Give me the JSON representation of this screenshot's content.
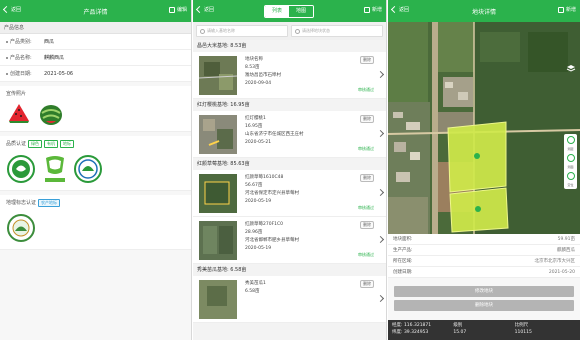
{
  "colors": {
    "accent": "#2bb24c",
    "map_field": "#cfe94a"
  },
  "p1": {
    "header": {
      "back": "返回",
      "title": "产品详情",
      "action": "编辑"
    },
    "section": "产品信息",
    "fields": [
      {
        "label": "产品类别:",
        "value": "西瓜"
      },
      {
        "label": "产品名称:",
        "value": "麒麟西瓜"
      },
      {
        "label": "创建日期:",
        "value": "2021-05-06"
      }
    ],
    "photos_title": "宣传照片",
    "cert_title": "品质认证",
    "cert_tags": [
      "绿色",
      "有机",
      "地标"
    ],
    "geo_title": "地理标志认证",
    "geo_tag": "农产地标"
  },
  "p2": {
    "header": {
      "back": "返回",
      "tab_list": "列表",
      "tab_map": "地图",
      "action": "新增"
    },
    "search": {
      "left": "请输入基地名称",
      "right": "请选择地块状态"
    },
    "groups": [
      {
        "title": "昌邑大米基地: 8.53亩",
        "items": [
          {
            "name": "地块名称",
            "area": "8.53亩",
            "addr": "潍坊昌邑市石埠村",
            "date": "2020-09-04",
            "del": "删除",
            "status": "审核通过"
          }
        ]
      },
      {
        "title": "红灯樱桃基地: 16.95亩",
        "items": [
          {
            "name": "红灯樱桃1",
            "area": "16.95亩",
            "addr": "山东省济宁市任城区西王庄村",
            "date": "2020-05-21",
            "del": "删除",
            "status": "审核通过"
          }
        ]
      },
      {
        "title": "红颜草莓基地: 85.63亩",
        "items": [
          {
            "name": "红颜草莓1610C48",
            "area": "56.67亩",
            "addr": "河北省保定市定兴县草莓村",
            "date": "2020-05-19",
            "del": "删除",
            "status": "审核通过"
          },
          {
            "name": "红颜草莓270F1C0",
            "area": "28.96亩",
            "addr": "河北省邯郸市肥乡县草莓村",
            "date": "2020-05-19",
            "del": "删除",
            "status": "审核通过"
          }
        ]
      },
      {
        "title": "秀美苗瓜基地: 6.58亩",
        "items": [
          {
            "name": "秀美苗瓜1",
            "area": "6.58亩",
            "addr": "",
            "date": "",
            "del": "删除",
            "status": ""
          }
        ]
      }
    ]
  },
  "p3": {
    "header": {
      "back": "返回",
      "title": "地块详情",
      "action": "新增"
    },
    "tools": [
      "测距",
      "测面",
      "定位"
    ],
    "info": [
      {
        "label": "地块面积:",
        "value": "59.91亩"
      },
      {
        "label": "生产产品:",
        "value": "麒麟西瓜"
      },
      {
        "label": "所在区域:",
        "value": "北京市北京市大兴区"
      },
      {
        "label": "创建日期:",
        "value": "2021-05-20"
      }
    ],
    "btn_edit": "修改地块",
    "btn_delete": "删除地块",
    "status": {
      "coord_lng": "经度: 116.321871",
      "coord_lat": "纬度: 39.324953",
      "level_label": "级别",
      "level_value": "15.07",
      "scale_label": "比例尺",
      "scale_value": "110115"
    }
  }
}
